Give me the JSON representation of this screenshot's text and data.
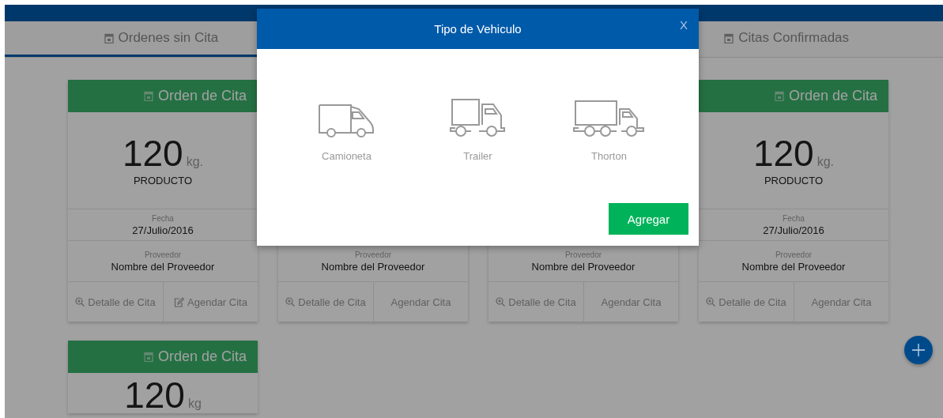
{
  "tabs": [
    {
      "label": "Ordenes sin Cita",
      "selected": true
    },
    {
      "label": "Citas Confirmadas",
      "selected": false
    }
  ],
  "cards": [
    {
      "title": "Orden de Cita",
      "amount": "120",
      "unit": "kg.",
      "product": "PRODUCTO",
      "date_label": "Fecha",
      "date": "27/Julio/2016",
      "supplier_label": "Proveedor",
      "supplier": "Nombre del Proveedor",
      "actions": [
        {
          "label": "Detalle de Cita",
          "has_icon": true
        },
        {
          "label": "Agendar Cita",
          "has_icon": true
        }
      ]
    },
    {
      "supplier_label": "Proveedor",
      "supplier": "Nombre del Proveedor",
      "actions": [
        {
          "label": "Detalle de Cita",
          "has_icon": true
        },
        {
          "label": "Agendar Cita",
          "has_icon": false
        }
      ]
    },
    {
      "supplier_label": "Proveedor",
      "supplier": "Nombre del Proveedor",
      "actions": [
        {
          "label": "Detalle de Cita",
          "has_icon": true
        },
        {
          "label": "Agendar Cita",
          "has_icon": false
        }
      ]
    },
    {
      "title": "Orden de Cita",
      "amount": "120",
      "unit": "kg.",
      "product": "PRODUCTO",
      "date_label": "Fecha",
      "date": "27/Julio/2016",
      "supplier_label": "Proveedor",
      "supplier": "Nombre del Proveedor",
      "actions": [
        {
          "label": "Detalle de Cita",
          "has_icon": true
        },
        {
          "label": "Agendar Cita",
          "has_icon": false
        }
      ]
    },
    {
      "title": "Orden de Cita",
      "amount": "120",
      "unit": "kg"
    }
  ],
  "modal": {
    "title": "Tipo de Vehiculo",
    "close": "X",
    "vehicles": [
      {
        "kind": "van",
        "label": "Camioneta"
      },
      {
        "kind": "truck",
        "label": "Trailer"
      },
      {
        "kind": "long-truck",
        "label": "Thorton"
      }
    ],
    "button": "Agregar"
  }
}
